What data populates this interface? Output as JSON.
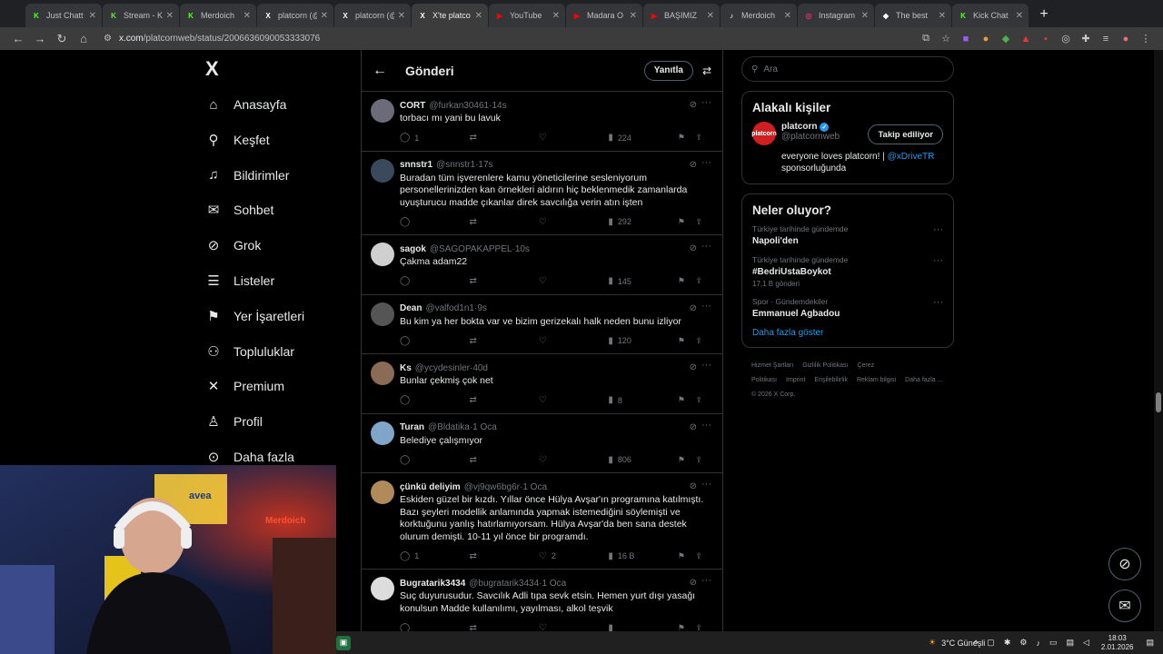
{
  "browser": {
    "tabs": [
      {
        "label": "Just Chatt",
        "color": "#53fc18",
        "icon": "K"
      },
      {
        "label": "Stream - K",
        "color": "#53fc18",
        "icon": "K"
      },
      {
        "label": "Merdoich",
        "color": "#53fc18",
        "icon": "K"
      },
      {
        "label": "platcorn (@",
        "color": "#ffffff",
        "icon": "X"
      },
      {
        "label": "platcorn (@",
        "color": "#ffffff",
        "icon": "X"
      },
      {
        "label": "X'te platco",
        "color": "#ffffff",
        "icon": "X",
        "active": true
      },
      {
        "label": "YouTube",
        "color": "#ff0000",
        "icon": "▶"
      },
      {
        "label": "Madara O",
        "color": "#ff0000",
        "icon": "▶"
      },
      {
        "label": "BAŞIMIZ",
        "color": "#ff0000",
        "icon": "▶"
      },
      {
        "label": "Merdoich",
        "color": "#ffffff",
        "icon": "♪"
      },
      {
        "label": "Instagram",
        "color": "#e1306c",
        "icon": "◎"
      },
      {
        "label": "The best",
        "color": "#ffffff",
        "icon": "◆"
      },
      {
        "label": "Kick Chat",
        "color": "#53fc18",
        "icon": "K"
      }
    ],
    "url_host": "x.com",
    "url_path": "/platcornweb/status/2006636090053333076"
  },
  "nav": {
    "logo": "X",
    "items": [
      {
        "label": "Anasayfa",
        "icon": "home-icon",
        "glyph": "⌂"
      },
      {
        "label": "Keşfet",
        "icon": "search-icon",
        "glyph": "⚲"
      },
      {
        "label": "Bildirimler",
        "icon": "bell-icon",
        "glyph": "♫"
      },
      {
        "label": "Sohbet",
        "icon": "mail-icon",
        "glyph": "✉"
      },
      {
        "label": "Grok",
        "icon": "grok-icon",
        "glyph": "⊘"
      },
      {
        "label": "Listeler",
        "icon": "list-icon",
        "glyph": "☰"
      },
      {
        "label": "Yer İşaretleri",
        "icon": "bookmark-icon",
        "glyph": "⚑"
      },
      {
        "label": "Topluluklar",
        "icon": "communities-icon",
        "glyph": "⚇"
      },
      {
        "label": "Premium",
        "icon": "x-premium-icon",
        "glyph": "✕"
      },
      {
        "label": "Profil",
        "icon": "profile-icon",
        "glyph": "♙"
      },
      {
        "label": "Daha fazla",
        "icon": "more-icon",
        "glyph": "⊙"
      }
    ]
  },
  "header": {
    "title": "Gönderi",
    "reply_label": "Yanıtla"
  },
  "tweets": [
    {
      "name": "CORT",
      "handle": "@furkan30461",
      "time": "14s",
      "text": "torbacı mı yani bu lavuk",
      "replies": "1",
      "views": "224",
      "likes": "",
      "avatar": "#6b6b7a"
    },
    {
      "name": "snnstr1",
      "handle": "@snnstr1",
      "time": "17s",
      "text": "Buradan tüm işverenlere kamu yöneticilerine sesleniyorum personellerinizden kan örnekleri aldırın hiç beklenmedik zamanlarda uyuşturucu madde çıkanlar direk savcılığa verin atın işten",
      "replies": "",
      "views": "292",
      "likes": "",
      "avatar": "#3a4a5c"
    },
    {
      "name": "sagok",
      "handle": "@SAGOPAKAPPEL",
      "time": "10s",
      "text": "Çakma adam22",
      "replies": "",
      "views": "145",
      "likes": "",
      "avatar": "#cfcfcf"
    },
    {
      "name": "Dean",
      "handle": "@valfod1n1",
      "time": "9s",
      "text": "Bu kim ya her bokta var ve bizim gerizekalı halk neden bunu izliyor",
      "replies": "",
      "views": "120",
      "likes": "",
      "avatar": "#555555"
    },
    {
      "name": "Ks",
      "handle": "@ycydesinler",
      "time": "40d",
      "text": "Bunlar çekmiş çok net",
      "replies": "",
      "views": "8",
      "likes": "",
      "avatar": "#8a6b55"
    },
    {
      "name": "Turan",
      "handle": "@Bldatika",
      "time": "1 Oca",
      "text": "Belediye çalışmıyor",
      "replies": "",
      "views": "806",
      "likes": "",
      "avatar": "#7fa6c9"
    },
    {
      "name": "çünkü deliyim",
      "handle": "@vj9qw6bg6r",
      "time": "1 Oca",
      "text": "Eskiden güzel bir kızdı. Yıllar önce Hülya Avşar'ın programına katılmıştı. Bazı şeyleri modellik anlamında yapmak istemediğini söylemişti ve korktuğunu yanlış hatırlamıyorsam. Hülya Avşar'da ben sana destek olurum demişti. 10-11 yıl önce bir programdı.",
      "replies": "1",
      "views": "16 B",
      "likes": "2",
      "avatar": "#b08a5a"
    },
    {
      "name": "Bugratarik3434",
      "handle": "@bugratarik3434",
      "time": "1 Oca",
      "text": "Suç duyurusudur. Savcılık Adli tıpa sevk etsin. Hemen yurt dışı yasağı konulsun Madde kullanılımı, yayılması, alkol teşvik",
      "replies": "",
      "views": "",
      "likes": "",
      "avatar": "#dddddd"
    }
  ],
  "search": {
    "placeholder": "Ara"
  },
  "related": {
    "title": "Alakalı kişiler",
    "name": "platcorn",
    "handle": "@platcornweb",
    "avatar_text": "platcorn",
    "follow_label": "Takip ediliyor",
    "bio_prefix": "everyone loves platcorn! | ",
    "bio_link": "@xDriveTR",
    "bio_suffix": "sponsorluğunda"
  },
  "trends": {
    "title": "Neler oluyor?",
    "items": [
      {
        "context": "Türkiye tarihinde gündemde",
        "title": "Napoli'den",
        "count": ""
      },
      {
        "context": "Türkiye tarihinde gündemde",
        "title": "#BedriUstaBoykot",
        "count": "17,1 B gönderi"
      },
      {
        "context": "Spor · Gündemdekiler",
        "title": "Emmanuel Agbadou",
        "count": ""
      }
    ],
    "show_more": "Daha fazla göster"
  },
  "footer": {
    "links": [
      "Hizmet Şartları",
      "Gizlilik Politikası",
      "Çerez Politikası",
      "Imprint",
      "Erişilebilirlik",
      "Reklam bilgisi",
      "Daha fazla ..."
    ],
    "copyright": "© 2026 X Corp."
  },
  "webcam": {
    "shirt_text": "avea",
    "sign_text": "Merdoich"
  },
  "taskbar": {
    "weather": "3°C  Güneşli",
    "time": "18:03",
    "date": "2.01.2026"
  }
}
